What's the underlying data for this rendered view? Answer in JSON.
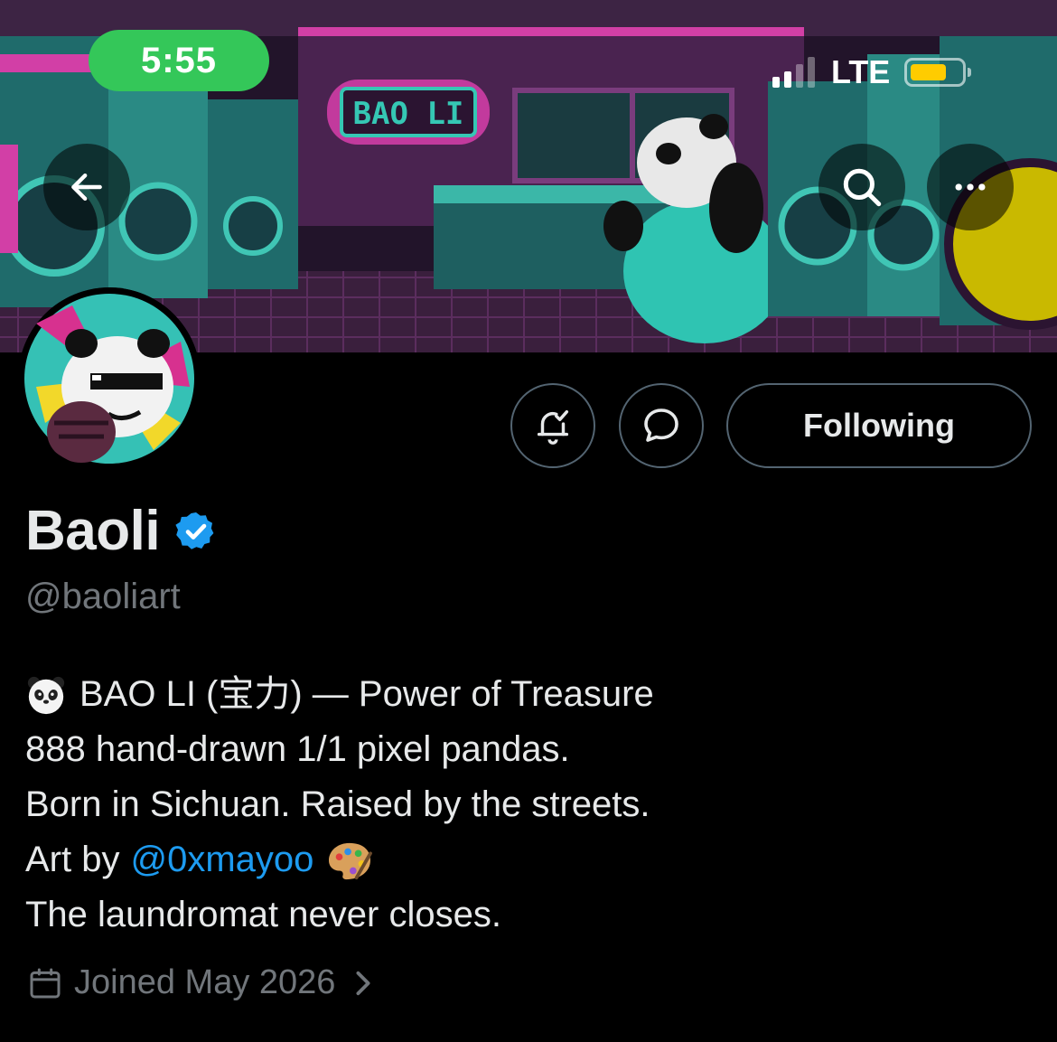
{
  "status_bar": {
    "time": "5:55",
    "network": "LTE",
    "signal_bars_active": 2,
    "signal_bars_total": 4,
    "battery_level": 0.62,
    "battery_color": "#ffcc00",
    "time_pill_color": "#34c759"
  },
  "banner": {
    "sign_text": "BAO LI"
  },
  "nav": {
    "back_icon": "arrow-left-icon",
    "search_icon": "search-icon",
    "more_icon": "more-dots-icon"
  },
  "actions": {
    "notify_icon": "bell-check-icon",
    "message_icon": "message-bubble-icon",
    "following_label": "Following"
  },
  "profile": {
    "display_name": "Baoli",
    "verified": true,
    "verified_color": "#1d9bf0",
    "handle": "@baoliart",
    "bio": {
      "line1": "BAO LI (宝力) — Power of Treasure",
      "line2": "888 hand-drawn 1/1 pixel pandas.",
      "line3": "Born in Sichuan. Raised by the streets.",
      "line4_prefix": "Art by",
      "line4_mention": "@0xmayoo",
      "line5": "The laundromat never closes."
    },
    "joined": "Joined May 2026"
  },
  "colors": {
    "background": "#000000",
    "text_primary": "#e7e9ea",
    "text_secondary": "#71767b",
    "link": "#1d9bf0",
    "border": "#536471"
  }
}
